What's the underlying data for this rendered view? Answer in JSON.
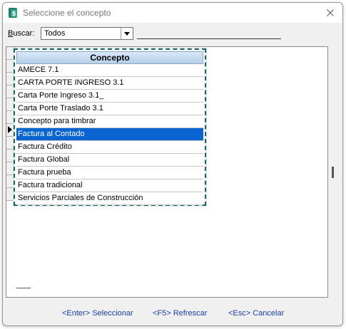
{
  "window": {
    "title": "Seleccione el concepto"
  },
  "toolbar": {
    "buscar_prefix": "B",
    "buscar_rest": "uscar:",
    "combo_value": "Todos",
    "search_value": ""
  },
  "list": {
    "column_header": "Concepto",
    "selected_index": 5,
    "items": [
      {
        "label": "AMECE 7.1"
      },
      {
        "label": "CARTA PORTE INGRESO 3.1"
      },
      {
        "label": "Carta Porte Ingreso 3.1_"
      },
      {
        "label": "Carta Porte Traslado 3.1"
      },
      {
        "label": "Concepto para timbrar"
      },
      {
        "label": "Factura al Contado"
      },
      {
        "label": "Factura Crédito"
      },
      {
        "label": "Factura Global"
      },
      {
        "label": "Factura prueba"
      },
      {
        "label": "Factura tradicional"
      },
      {
        "label": "Servicios Parciales de Construcción"
      }
    ]
  },
  "footer": {
    "enter": "<Enter> Seleccionar",
    "f5": "<F5> Refrescar",
    "esc": "<Esc> Cancelar"
  },
  "colors": {
    "selection": "#0a64d2",
    "highlight_border": "#1b6464",
    "link": "#1a3cb0"
  }
}
